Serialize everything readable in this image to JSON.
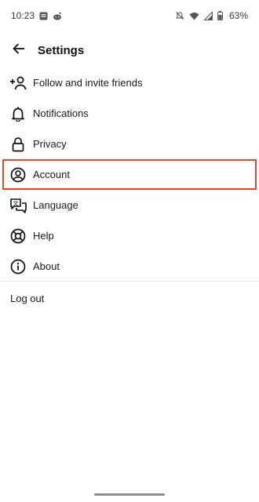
{
  "status_bar": {
    "time": "10:23",
    "battery": "63%",
    "icons": [
      "app-notification-icon",
      "reddit-icon",
      "mute-icon",
      "wifi-icon",
      "signal-icon",
      "battery-icon"
    ]
  },
  "header": {
    "title": "Settings",
    "back_icon": "arrow-left-icon"
  },
  "menu": {
    "items": [
      {
        "label": "Follow and invite friends",
        "icon": "add-person-icon"
      },
      {
        "label": "Notifications",
        "icon": "bell-icon"
      },
      {
        "label": "Privacy",
        "icon": "lock-icon"
      },
      {
        "label": "Account",
        "icon": "account-circle-icon",
        "highlighted": true
      },
      {
        "label": "Language",
        "icon": "translate-icon"
      },
      {
        "label": "Help",
        "icon": "lifebuoy-icon"
      },
      {
        "label": "About",
        "icon": "info-icon"
      }
    ],
    "logout": "Log out"
  },
  "colors": {
    "highlight": "#e8452b",
    "text": "#1a1a1a",
    "divider": "#e6e6e6"
  }
}
